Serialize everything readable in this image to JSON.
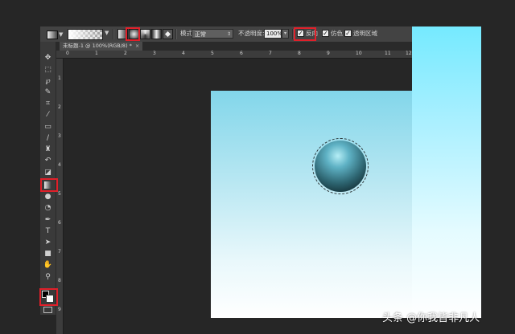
{
  "options_bar": {
    "mode_label": "模式:",
    "mode_value": "正常",
    "opacity_label": "不透明度:",
    "opacity_value": "100%",
    "reverse_label": "反向",
    "dither_label": "仿色",
    "transparency_label": "透明区域",
    "reverse_checked": true,
    "dither_checked": true,
    "transparency_checked": true,
    "gradient_types": [
      "linear-gradient-icon",
      "radial-gradient-icon",
      "angle-gradient-icon",
      "reflected-gradient-icon",
      "diamond-gradient-icon"
    ],
    "selected_gradient_type": "radial-gradient-icon"
  },
  "document_tab": {
    "title": "未标题-1 @ 100%(RGB/8) *",
    "close": "×"
  },
  "ruler_top": [
    "0",
    "1",
    "2",
    "3",
    "4",
    "5",
    "6",
    "7",
    "8",
    "9",
    "10",
    "11",
    "12"
  ],
  "ruler_left": [
    "1",
    "2",
    "3",
    "4",
    "5",
    "6",
    "7",
    "8",
    "9"
  ],
  "tools": [
    "move-tool-icon",
    "marquee-tool-icon",
    "lasso-tool-icon",
    "quick-select-tool-icon",
    "crop-tool-icon",
    "eyedropper-tool-icon",
    "healing-brush-tool-icon",
    "brush-tool-icon",
    "clone-stamp-tool-icon",
    "history-brush-tool-icon",
    "eraser-tool-icon",
    "gradient-tool-icon",
    "blur-tool-icon",
    "dodge-tool-icon",
    "pen-tool-icon",
    "type-tool-icon",
    "path-select-tool-icon",
    "shape-tool-icon",
    "hand-tool-icon",
    "zoom-tool-icon"
  ],
  "colors": {
    "foreground": "#000000",
    "background": "#ffffff",
    "highlight": "#e0202a",
    "canvas_top": "#82d6ea",
    "canvas_bottom": "#ffffff"
  },
  "watermark": "头条 @你我皆非凡人"
}
